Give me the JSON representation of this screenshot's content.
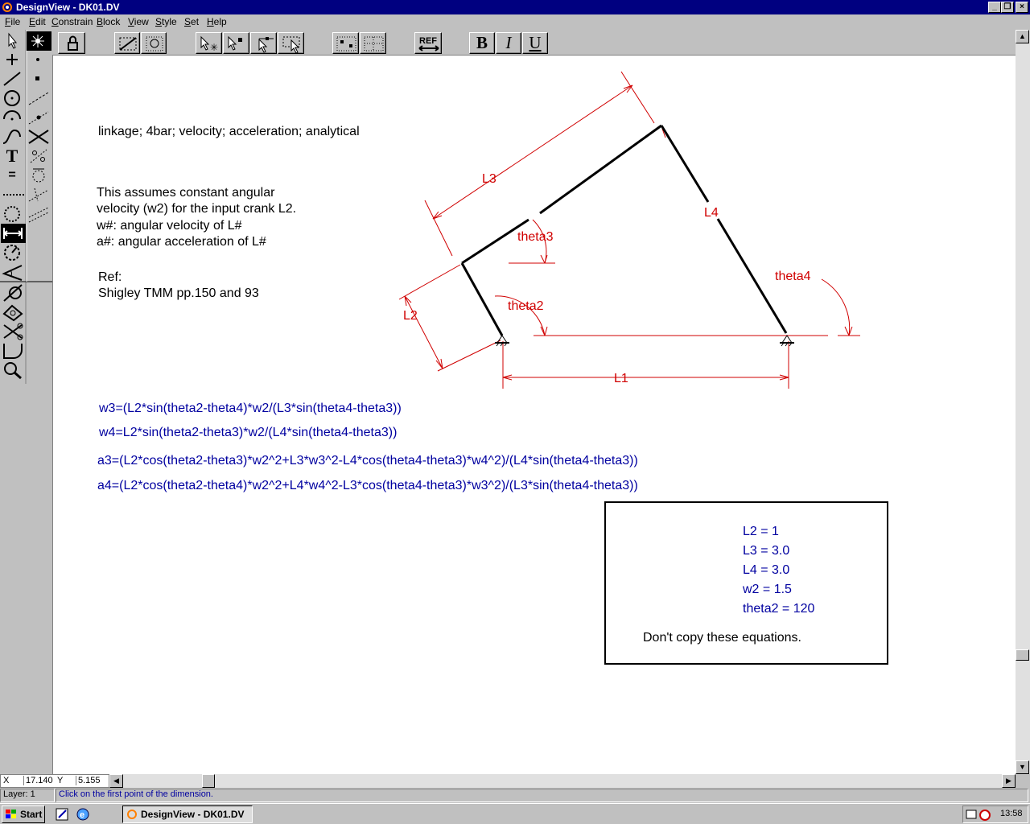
{
  "window": {
    "title": "DesignView - DK01.DV"
  },
  "menu": [
    {
      "label": "File",
      "u": "F",
      "rest": "ile"
    },
    {
      "label": "Edit",
      "u": "E",
      "rest": "dit"
    },
    {
      "label": "Constrain",
      "u": "C",
      "rest": "onstrain"
    },
    {
      "label": "Block",
      "u": "B",
      "rest": "lock"
    },
    {
      "label": "View",
      "u": "V",
      "rest": "iew"
    },
    {
      "label": "Style",
      "u": "S",
      "rest": "tyle"
    },
    {
      "label": "Set",
      "u": "S",
      "rest": "et"
    },
    {
      "label": "Help",
      "u": "H",
      "rest": "elp"
    }
  ],
  "toolbar": {
    "ref_label": "REF",
    "bold_label": "B",
    "italic_label": "I",
    "underline_label": "U"
  },
  "palette": {
    "text_tool_label": "T",
    "equals_tool_label": "="
  },
  "notes": {
    "keywords": "linkage; 4bar; velocity; acceleration; analytical",
    "desc1": "This assumes constant angular",
    "desc2": "velocity (w2) for the input crank L2.",
    "desc3": "w#: angular velocity of L#",
    "desc4": "a#: angular acceleration of L#",
    "ref_label": "Ref:",
    "ref_text": "Shigley TMM  pp.150 and 93"
  },
  "diagram": {
    "labels": {
      "L1": "L1",
      "L2": "L2",
      "L3": "L3",
      "L4": "L4",
      "theta2": "theta2",
      "theta3": "theta3",
      "theta4": "theta4"
    }
  },
  "equations": {
    "w3": "w3=(L2*sin(theta2-theta4)*w2/(L3*sin(theta4-theta3))",
    "w4": "w4=L2*sin(theta2-theta3)*w2/(L4*sin(theta4-theta3))",
    "a3": "a3=(L2*cos(theta2-theta3)*w2^2+L3*w3^2-L4*cos(theta4-theta3)*w4^2)/(L4*sin(theta4-theta3))",
    "a4": "a4=(L2*cos(theta2-theta4)*w2^2+L4*w4^2-L3*cos(theta4-theta3)*w3^2)/(L3*sin(theta4-theta3))"
  },
  "params": {
    "l2": "L2 = 1",
    "l3": "L3 = 3.0",
    "l4": "L4 = 3.0",
    "w2": "w2 = 1.5",
    "theta2": "theta2 = 120",
    "note": "Don't copy these equations."
  },
  "coords": {
    "x_label": "X",
    "x_value": "17.140",
    "y_label": "Y",
    "y_value": "5.155"
  },
  "status": {
    "layer": "Layer: 1",
    "message": "Click on the first point of the dimension."
  },
  "taskbar": {
    "start_label": "Start",
    "app_label": "DesignView - DK01.DV",
    "clock": "13:58"
  },
  "colors": {
    "titlebar": "#000080",
    "dimension_red": "#d00000",
    "equation_blue": "#0000a0"
  }
}
